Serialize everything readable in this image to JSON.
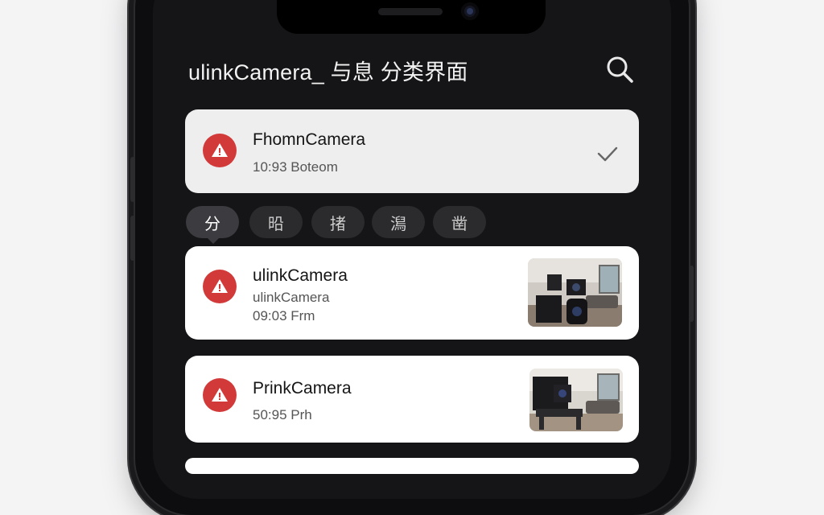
{
  "header": {
    "title": "ulinkCamera_ 与息 分类界面"
  },
  "filters": [
    {
      "label": "分",
      "active": true
    },
    {
      "label": "㫟"
    },
    {
      "label": "㨋"
    },
    {
      "label": "澙"
    },
    {
      "label": "凿"
    }
  ],
  "pinned": {
    "title": "FhomnCamera",
    "subtitle": "10:93 Boteom"
  },
  "notifications": [
    {
      "title": "ulinkCamera",
      "line1": "ulinkCamera",
      "line2": "09:03 Frm"
    },
    {
      "title": "PrinkCamera",
      "line1": "50:95 Prh"
    }
  ],
  "colors": {
    "alert": "#d23a3a",
    "screen": "#151517",
    "card": "#ffffff"
  },
  "icons": [
    "search-icon",
    "check-icon",
    "alert-icon",
    "camera-thumbnail"
  ]
}
